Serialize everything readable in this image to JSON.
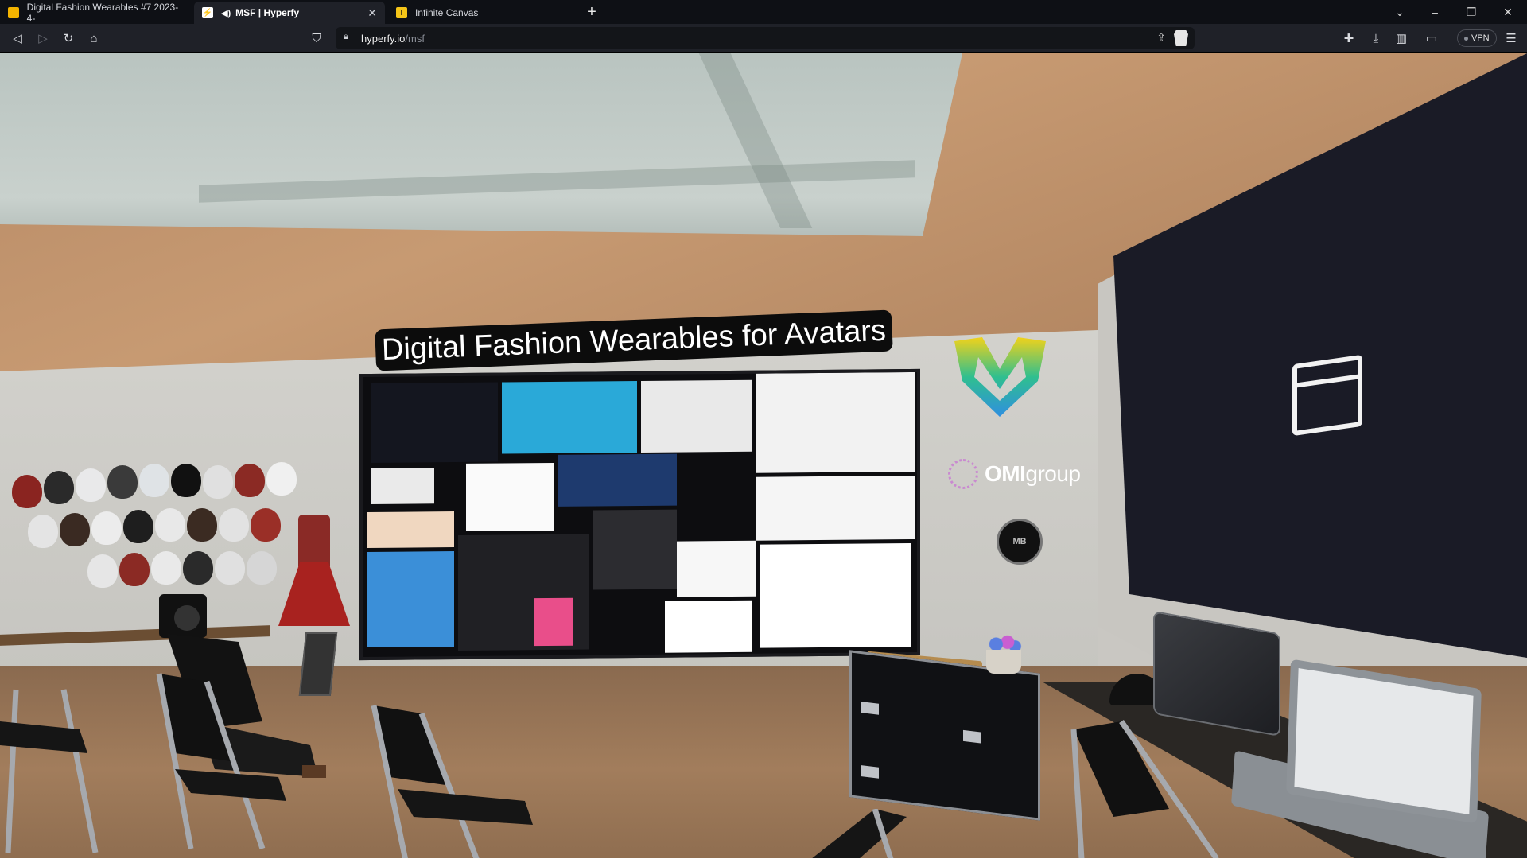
{
  "browser": {
    "tabs": [
      {
        "title": "Digital Fashion Wearables #7 2023-4-",
        "favicon_color": "#f4b400",
        "active": false
      },
      {
        "title": "MSF | Hyperfy",
        "favicon_color": "#ffffff",
        "active": true
      },
      {
        "title": "Infinite Canvas",
        "favicon_color": "#f5c518",
        "active": false
      }
    ],
    "new_tab_label": "+",
    "address": {
      "host": "hyperfy.io",
      "path": "/msf"
    },
    "vpn_label": "VPN",
    "window_controls": {
      "dropdown": "⌄",
      "minimize": "–",
      "restore": "❐",
      "close": "✕"
    }
  },
  "scene": {
    "banner_title": "Digital Fashion Wearables for Avatars",
    "omi_logo": {
      "bold": "OMI",
      "light": "group"
    },
    "seal_text": "MB",
    "colors": {
      "skylight": "#c2cbc7",
      "wood": "#b88d68",
      "wall": "#cfcdc8",
      "dark_panel": "#1a1b26",
      "banner": "#0c0c0c",
      "logo_gradient": [
        "#f2d21a",
        "#2fbf8f",
        "#2f8fe0"
      ]
    },
    "icons": [
      "window-frame-icon",
      "m-logo-icon",
      "omi-ring-icon",
      "seal-icon"
    ]
  }
}
